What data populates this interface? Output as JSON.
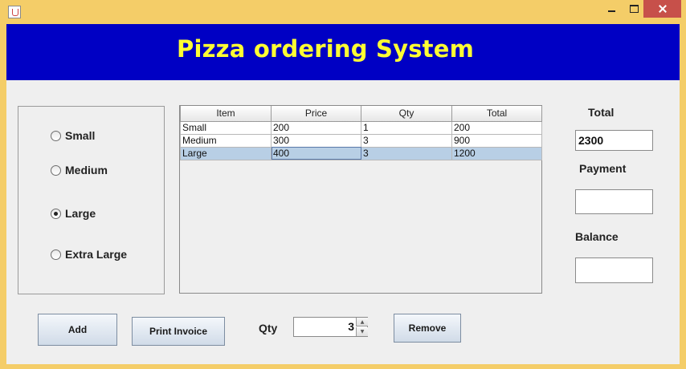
{
  "window": {
    "title": "",
    "icon": "java-cup-icon"
  },
  "banner": {
    "title": "Pizza ordering System"
  },
  "sizes": [
    {
      "label": "Small",
      "checked": false
    },
    {
      "label": "Medium",
      "checked": false
    },
    {
      "label": "Large",
      "checked": true
    },
    {
      "label": "Extra Large",
      "checked": false
    }
  ],
  "table": {
    "columns": [
      "Item",
      "Price",
      "Qty",
      "Total"
    ],
    "rows": [
      [
        "Small",
        "200",
        "1",
        "200"
      ],
      [
        "Medium",
        "300",
        "3",
        "900"
      ],
      [
        "Large",
        "400",
        "3",
        "1200"
      ]
    ],
    "selected_row": 2
  },
  "summary": {
    "total_label": "Total",
    "total_value": "2300",
    "payment_label": "Payment",
    "payment_value": "",
    "balance_label": "Balance",
    "balance_value": ""
  },
  "actions": {
    "add_label": "Add",
    "print_label": "Print Invoice",
    "qty_label": "Qty",
    "qty_value": "3",
    "remove_label": "Remove"
  },
  "colors": {
    "banner_bg": "#0000c4",
    "banner_text": "#ffff33",
    "frame": "#f4cd68",
    "close_button": "#c7504a"
  }
}
